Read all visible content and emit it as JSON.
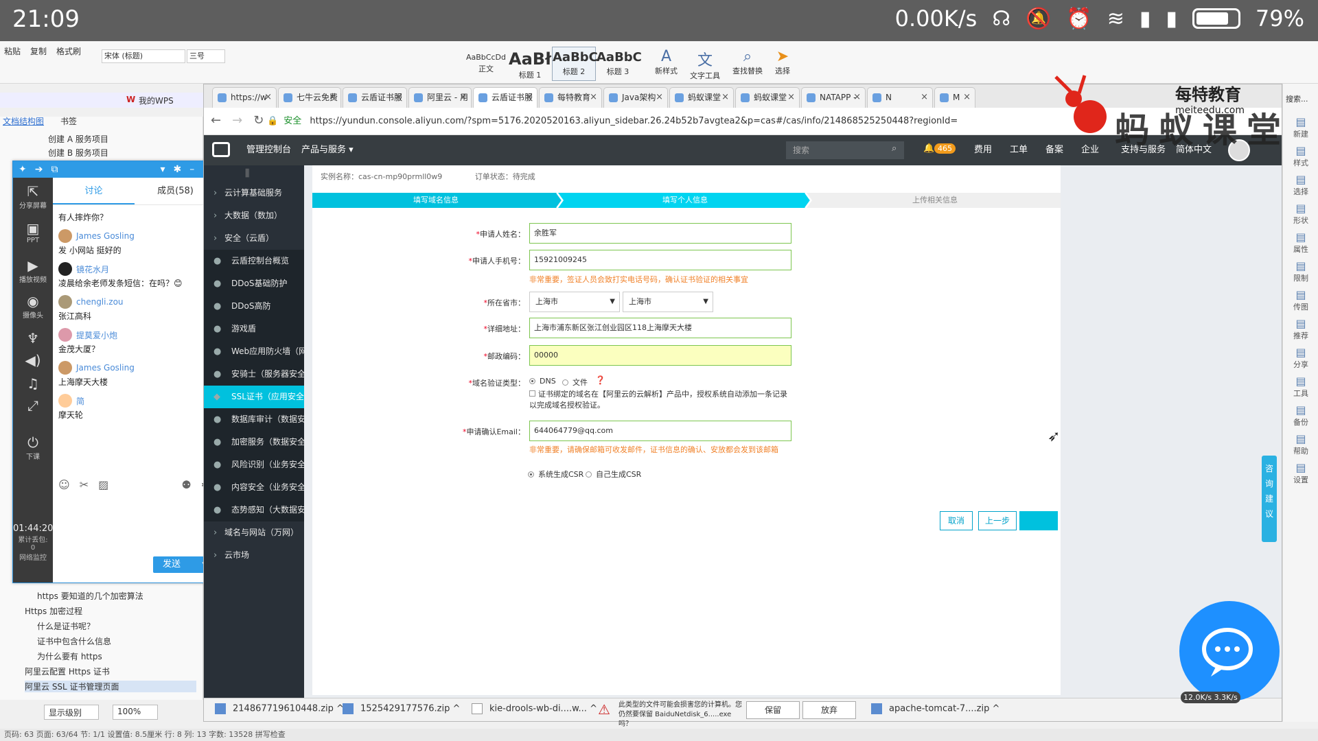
{
  "status_bar": {
    "time": "21:09",
    "net_speed": "0.00K/s",
    "battery": "79%",
    "battery_level": 0.79
  },
  "ribbon": {
    "left_labels": [
      "粘贴",
      "复制",
      "格式刷"
    ],
    "font": "宋体 (标题)",
    "size": "三号",
    "styles": [
      {
        "sample": "AaBbCcDd",
        "name": "正文"
      },
      {
        "sample": "AaBł",
        "name": "标题 1"
      },
      {
        "sample": "AaBbC",
        "name": "标题 2"
      },
      {
        "sample": "AaBbC",
        "name": "标题 3"
      }
    ],
    "tools": [
      "新样式",
      "文字工具",
      "查找替换",
      "选择"
    ]
  },
  "wps": {
    "label": "我的WPS",
    "nav_tabs": [
      "文档结构图",
      "书签"
    ]
  },
  "doc_nav": [
    "创建 A 服务项目",
    "创建 B 服务项目",
    "https 要知道的几个加密算法",
    "Https 加密过程",
    "什么是证书呢？",
    "证书中包含什么信息",
    "为什么要有 https",
    "阿里云配置 Https 证书",
    "阿里云 SSL 证书管理页面"
  ],
  "word_bottom": {
    "display_level": "显示级别",
    "zoom": "100%"
  },
  "word_status": "页码: 63  页面: 63/64  节: 1/1  设置值: 8.5厘米  行: 8  列: 13  字数: 13528  拼写检查",
  "chat": {
    "tabs": [
      "讨论",
      "成员(58)"
    ],
    "side": [
      "分享屏幕",
      "PPT",
      "播放视频",
      "摄像头",
      "下课"
    ],
    "timer": "01:44:20",
    "timer_sub": [
      "累计丢包:",
      "0",
      "网络监控"
    ],
    "messages": [
      {
        "name": "",
        "text": "有人摔炸你？"
      },
      {
        "name": "James Gosling",
        "text": "发 小网站 挺好的"
      },
      {
        "name": "镜花水月",
        "text": "凌晨给余老师发条短信：在吗？😊"
      },
      {
        "name": "chengli.zou",
        "text": "张江高科"
      },
      {
        "name": "提莫爱小炮",
        "text": "金茂大厦？"
      },
      {
        "name": "James Gosling",
        "text": "上海摩天大楼"
      },
      {
        "name": "简",
        "text": "摩天轮"
      }
    ],
    "send": "发送"
  },
  "browser": {
    "tabs": [
      {
        "title": "https://w"
      },
      {
        "title": "七牛云免费"
      },
      {
        "title": "云盾证书服"
      },
      {
        "title": "阿里云 - 用"
      },
      {
        "title": "云盾证书服"
      },
      {
        "title": "每特教育"
      },
      {
        "title": "Java架构"
      },
      {
        "title": "蚂蚁课堂"
      },
      {
        "title": "蚂蚁课堂"
      },
      {
        "title": "NATAPP -"
      },
      {
        "title": "N"
      },
      {
        "title": "M"
      }
    ],
    "secure_label": "安全",
    "url": "https://yundun.console.aliyun.com/?spm=5176.2020520163.aliyun_sidebar.26.24b52b7avgtea2&p=cas#/cas/info/214868525250448?regionId="
  },
  "topnav": {
    "console": "管理控制台",
    "products": "产品与服务 ▾",
    "search_placeholder": "搜索",
    "notifications": "465",
    "links": [
      "费用",
      "工单",
      "备案",
      "企业",
      "支持与服务",
      "简体中文"
    ]
  },
  "sidebar": {
    "items": [
      {
        "label": "云计算基础服务",
        "kind": "grp"
      },
      {
        "label": "大数据（数加）",
        "kind": "grp"
      },
      {
        "label": "安全（云盾）",
        "kind": "grp"
      },
      {
        "label": "云盾控制台概览",
        "kind": "sub"
      },
      {
        "label": "DDoS基础防护",
        "kind": "sub"
      },
      {
        "label": "DDoS高防",
        "kind": "sub"
      },
      {
        "label": "游戏盾",
        "kind": "sub"
      },
      {
        "label": "Web应用防火墙（网...",
        "kind": "sub"
      },
      {
        "label": "安骑士（服务器安全）",
        "kind": "sub"
      },
      {
        "label": "SSL证书（应用安全）",
        "kind": "active"
      },
      {
        "label": "数据库审计（数据安...",
        "kind": "sub"
      },
      {
        "label": "加密服务（数据安全）",
        "kind": "sub"
      },
      {
        "label": "风险识别（业务安全）",
        "kind": "sub"
      },
      {
        "label": "内容安全（业务安全）",
        "kind": "sub"
      },
      {
        "label": "态势感知（大数据安...",
        "kind": "sub"
      },
      {
        "label": "域名与网站（万网）",
        "kind": "grp"
      },
      {
        "label": "云市场",
        "kind": "grp"
      }
    ]
  },
  "order": {
    "instance": "实例名称：cas-cn-mp90prmll0w9",
    "status": "订单状态：待完成"
  },
  "steps": [
    "填写域名信息",
    "填写个人信息",
    "上传相关信息"
  ],
  "form": {
    "name_label": "申请人姓名：",
    "name_value": "余胜军",
    "phone_label": "申请人手机号：",
    "phone_value": "15921009245",
    "phone_hint": "非常重要，签证人员会致打实电话号码，确认证书验证的相关事宜",
    "region_label": "所在省市：",
    "province": "上海市",
    "city": "上海市",
    "address_label": "详细地址：",
    "address_value": "上海市浦东新区张江创业园区118上海摩天大楼",
    "zip_label": "邮政编码：",
    "zip_value": "00000",
    "verify_label": "域名验证类型：",
    "verify_dns": "DNS",
    "verify_file": "文件",
    "verify_check": "证书绑定的域名在【阿里云的云解析】产品中，授权系统自动添加一条记录以完成域名授权验证。",
    "email_label": "申请确认Email：",
    "email_value": "644064779@qq.com",
    "email_hint": "非常重要，请确保邮箱可收发邮件，证书信息的确认、安放都会发到该邮箱",
    "csr_system": "系统生成CSR",
    "csr_self": "自己生成CSR",
    "cancel": "取消",
    "prev": "上一步"
  },
  "downloads": {
    "items": [
      "214867719610448.zip",
      "1525429177576.zip",
      "kie-drools-wb-di....w...",
      "apache-tomcat-7....zip"
    ],
    "warning": "此类型的文件可能会损害您的计算机。您仍然要保留 BaiduNetdisk_6.....exe 吗？",
    "keep": "保留",
    "discard": "放弃"
  },
  "watermark": {
    "brand": "蚂蚁课堂",
    "meite": "每特教育",
    "meite_url": "meiteedu.com"
  },
  "right_pane": [
    "新建",
    "样式",
    "选择",
    "形状",
    "属性",
    "限制",
    "传图",
    "推荐",
    "分享",
    "工具",
    "备份",
    "帮助",
    "设置"
  ],
  "right_search": "搜索...",
  "consult_btn": "咨询建议",
  "speed_badge": "12.0K/s 3.3K/s",
  "colors": {
    "accent": "#00c1de",
    "topnav": "#373d41",
    "sidebar": "#293038",
    "hint": "#f0822a"
  }
}
